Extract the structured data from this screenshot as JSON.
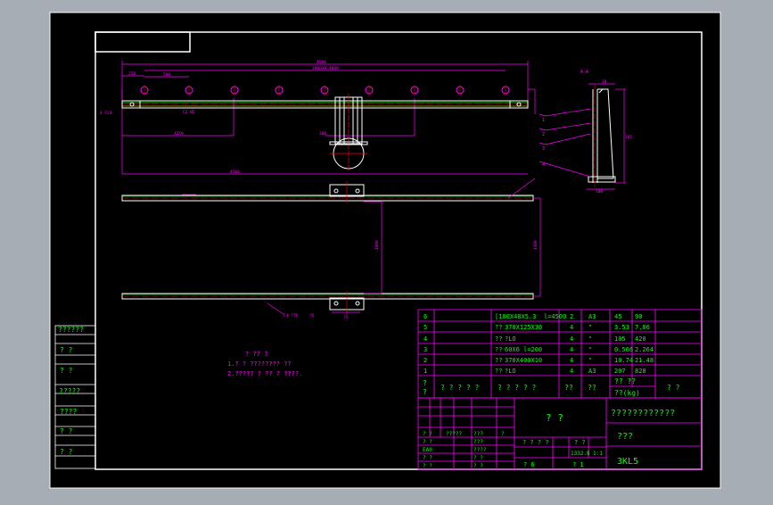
{
  "colors": {
    "background": "#a6adb5",
    "sheet": "#000000",
    "frame": "#ffffff",
    "dimension": "#ff00ff",
    "text_green": "#00ff00",
    "table_lines": "#ff00ff",
    "part_outline": "#ffffff",
    "centerline": "#ff0000",
    "accent": "#ffff00"
  },
  "side_stamp": {
    "labels": [
      "??????",
      "?    ?",
      "?    ?",
      "?????",
      "????",
      "?    ?",
      "?    ?"
    ]
  },
  "notes": {
    "heading": "? ?? ?",
    "line1": "1.? ? ???????? ??",
    "line2": "2.????? ? ?? ? ????."
  },
  "bom": {
    "rows": [
      {
        "no": "6",
        "code": "",
        "name": "[100X48X5.3",
        "spec": "l=4500",
        "qty": "2",
        "mat": "A3",
        "unit": "45",
        "total": "90"
      },
      {
        "no": "5",
        "code": "",
        "name": "??",
        "spec": "370X125X30",
        "qty": "4",
        "mat": "\"",
        "unit": "3.53",
        "total": "7.06"
      },
      {
        "no": "4",
        "code": "",
        "name": "??",
        "spec": "?LO",
        "qty": "4",
        "mat": "\"",
        "unit": "105",
        "total": "420"
      },
      {
        "no": "3",
        "code": "",
        "name": "??",
        "spec": "60X6     l=200",
        "qty": "4",
        "mat": "\"",
        "unit": "0.566",
        "total": "2.264"
      },
      {
        "no": "2",
        "code": "",
        "name": "??",
        "spec": "370X400X10",
        "qty": "4",
        "mat": "\"",
        "unit": "10.74",
        "total": "21.48"
      },
      {
        "no": "1",
        "code": "",
        "name": "??",
        "spec": "?LO",
        "qty": "4",
        "mat": "A3",
        "unit": "207",
        "total": "828"
      }
    ],
    "header": {
      "no": "?\n?",
      "code": "? ? ? ? ?",
      "name": "? ? ? ? ?",
      "qty": "??",
      "mat": "??",
      "weight_top": "?? ??",
      "weight_bottom": "??(kg)",
      "remark": "? ?"
    }
  },
  "title_block": {
    "drawing_name": "?  ?",
    "company": "????????????",
    "material_cell": "???",
    "drawing_no": "3KL5",
    "scale_label": "? ? ? ?",
    "weight_label": "? ?",
    "scale_value": "1:1",
    "weight_value": "1332.8",
    "sheet_total": "? 6",
    "sheet_no": "? 1",
    "left_rows": [
      [
        "? ?",
        "?????",
        "???",
        "?"
      ],
      [
        "? ?",
        "",
        "???",
        ""
      ],
      [
        "EA0",
        "",
        "????",
        ""
      ],
      [
        "? ?",
        "",
        "? ?",
        ""
      ],
      [
        "? ?",
        "",
        "? ?",
        ""
      ]
    ]
  },
  "drawing": {
    "top_dims": [
      "4500",
      "3000X9=4000",
      "250",
      "500"
    ],
    "left_dims": [
      "1250",
      "4500",
      "300"
    ],
    "mid_dims": [
      "1800",
      "1300"
    ],
    "section_label": "A-A",
    "side_dims": [
      "30",
      "90",
      "130",
      "305",
      "100"
    ],
    "callouts": [
      "1",
      "2",
      "3",
      "4",
      "5",
      "6"
    ],
    "small_labels": [
      "4-?24",
      "C2-N5",
      "C4-?75",
      "?5",
      "?5"
    ]
  }
}
